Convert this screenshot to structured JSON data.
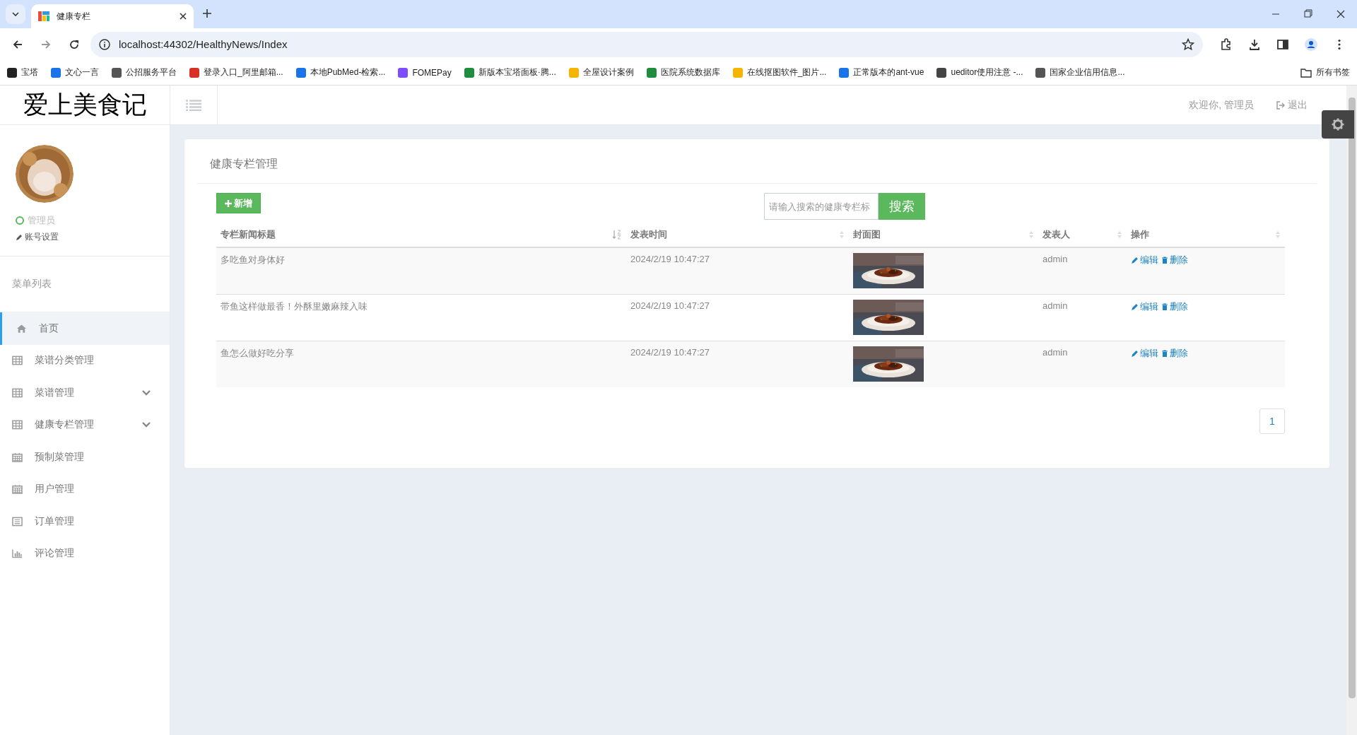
{
  "browser": {
    "tab_title": "健康专栏",
    "url": "localhost:44302/HealthyNews/Index",
    "bookmarks": [
      "宝塔",
      "文心一言",
      "公招服务平台",
      "登录入口_阿里邮箱...",
      "本地PubMed-检索...",
      "FOMEPay",
      "新版本宝塔面板·腾...",
      "全屋设计案例",
      "医院系统数据库",
      "在线抠图软件_图片...",
      "正常版本的ant-vue",
      "ueditor使用注意 -...",
      "国家企业信用信息..."
    ],
    "all_bookmarks": "所有书签"
  },
  "header": {
    "logo": "爱上美食记",
    "welcome": "欢迎你, 管理员",
    "logout": "退出"
  },
  "profile": {
    "role": "管理员",
    "settings": "账号设置"
  },
  "sidebar": {
    "heading": "菜单列表",
    "items": [
      {
        "label": "首页",
        "selected": true,
        "expandable": false
      },
      {
        "label": "菜谱分类管理",
        "selected": false,
        "expandable": false
      },
      {
        "label": "菜谱管理",
        "selected": false,
        "expandable": true
      },
      {
        "label": "健康专栏管理",
        "selected": false,
        "expandable": true
      },
      {
        "label": "预制菜管理",
        "selected": false,
        "expandable": false
      },
      {
        "label": "用户管理",
        "selected": false,
        "expandable": false
      },
      {
        "label": "订单管理",
        "selected": false,
        "expandable": false
      },
      {
        "label": "评论管理",
        "selected": false,
        "expandable": false
      }
    ]
  },
  "panel": {
    "title": "健康专栏管理",
    "add_button": "新增",
    "search": {
      "placeholder": "请输入搜索的健康专栏标",
      "button": "搜索"
    },
    "table": {
      "columns": [
        {
          "label": "专栏新闻标题",
          "sorted": true
        },
        {
          "label": "发表时间",
          "sorted": false
        },
        {
          "label": "封面图",
          "sorted": false
        },
        {
          "label": "发表人",
          "sorted": false
        },
        {
          "label": "操作",
          "sorted": false
        }
      ],
      "rows": [
        {
          "title": "多吃鱼对身体好",
          "time": "2024/2/19 10:47:27",
          "author": "admin",
          "edit": "编辑",
          "delete": "删除"
        },
        {
          "title": "带鱼这样做最香！外酥里嫩麻辣入味",
          "time": "2024/2/19 10:47:27",
          "author": "admin",
          "edit": "编辑",
          "delete": "删除"
        },
        {
          "title": "鱼怎么做好吃分享",
          "time": "2024/2/19 10:47:27",
          "author": "admin",
          "edit": "编辑",
          "delete": "删除"
        }
      ]
    },
    "pages": [
      "1"
    ]
  }
}
